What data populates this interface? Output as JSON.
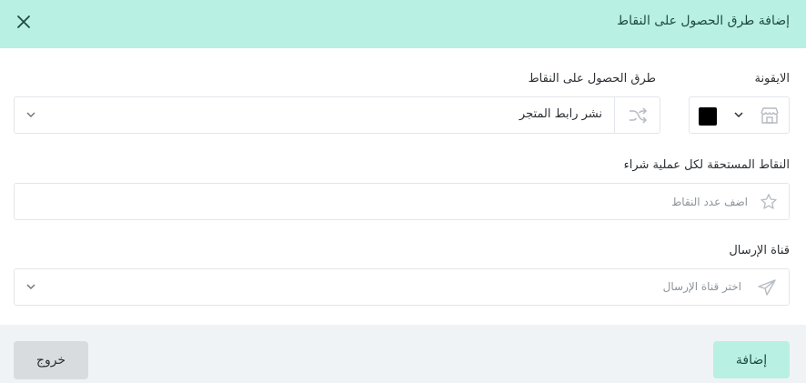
{
  "dialog": {
    "title": "إضافة طرق الحصول على النقاط"
  },
  "form": {
    "icon": {
      "label": "الايقونة",
      "icon_name": "store-icon",
      "selected_color": "#000000"
    },
    "method": {
      "label": "طرق الحصول على النقاط",
      "icon_name": "share-icon",
      "value": "نشر رابط المتجر"
    },
    "points": {
      "label": "النقاط المستحقة لكل عملية شراء",
      "icon_name": "star-icon",
      "placeholder": "اضف عدد النقاط",
      "value": ""
    },
    "channel": {
      "label": "قناة الإرسال",
      "icon_name": "send-icon",
      "placeholder": "اختر قناة الإرسال"
    }
  },
  "footer": {
    "add_label": "إضافة",
    "exit_label": "خروج"
  },
  "colors": {
    "header_bg": "#b8f0e3",
    "primary_button": "#b8f0e3",
    "secondary_button": "#d9dcdf",
    "footer_bg": "#f0f3f5"
  }
}
